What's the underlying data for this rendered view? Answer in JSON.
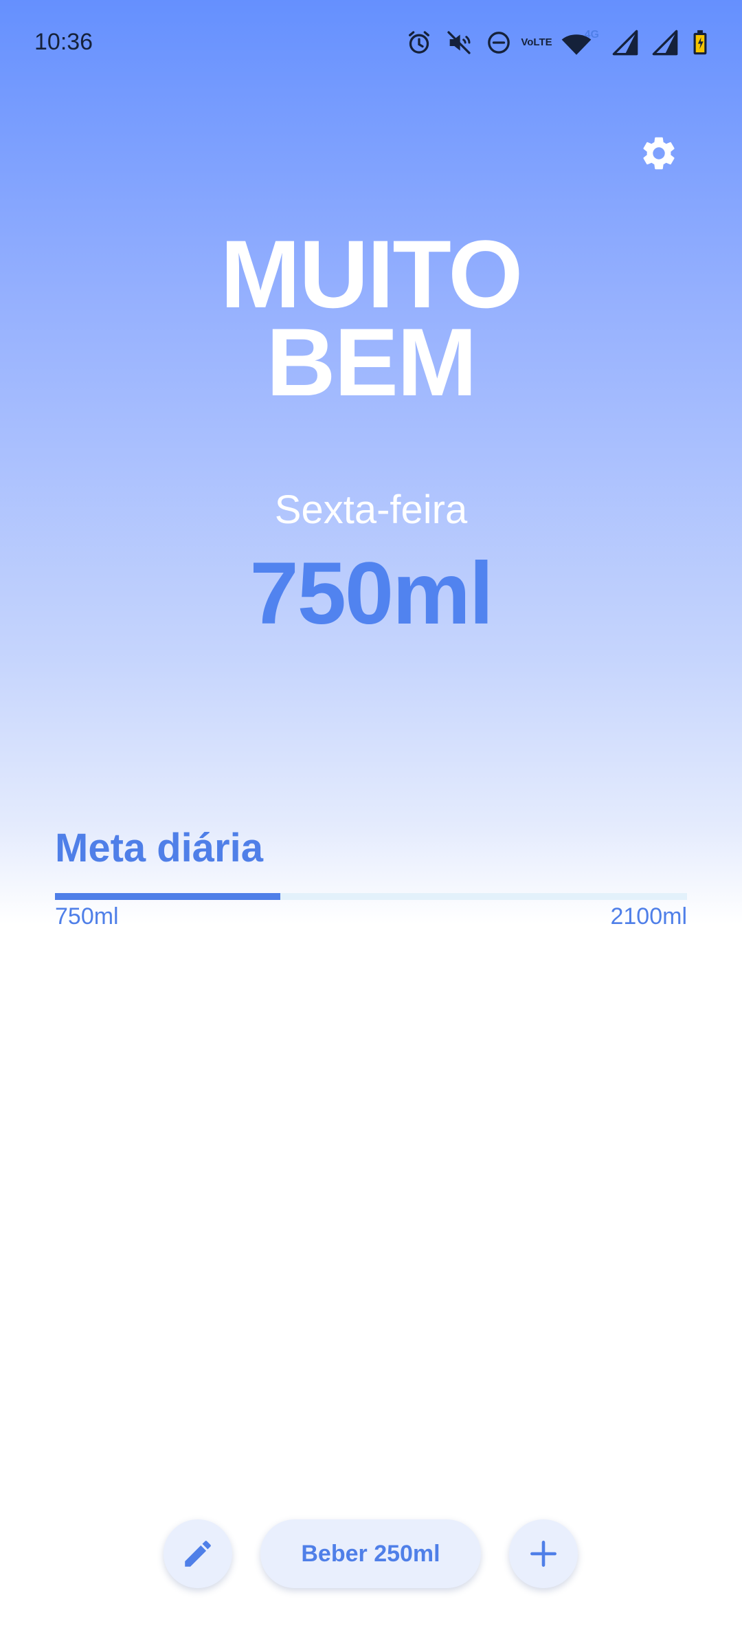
{
  "status_bar": {
    "time": "10:36",
    "volte_label_top": "Vo",
    "volte_label_bottom": "LTE",
    "network_tag": "4G",
    "icons": [
      "alarm-icon",
      "mute-icon",
      "dnd-icon",
      "volte-icon",
      "wifi-icon",
      "signal-icon",
      "signal-icon",
      "battery-charging-icon"
    ],
    "battery_color": "#f5c400"
  },
  "settings": {
    "icon": "gear-icon"
  },
  "hero": {
    "title_line1": "MUITO",
    "title_line2": "BEM",
    "day": "Sexta-feira",
    "amount": "750ml"
  },
  "goal": {
    "title": "Meta diária",
    "current_label": "750ml",
    "target_label": "2100ml",
    "progress_fraction": 0.357
  },
  "actions": {
    "edit_icon": "pencil-icon",
    "drink_label": "Beber 250ml",
    "add_icon": "plus-icon"
  },
  "colors": {
    "accent": "#4f7fe8",
    "amount": "#5183ef",
    "button_bg": "#e9effd",
    "track": "#e3f1fb",
    "gradient_top": "#6590fe"
  }
}
